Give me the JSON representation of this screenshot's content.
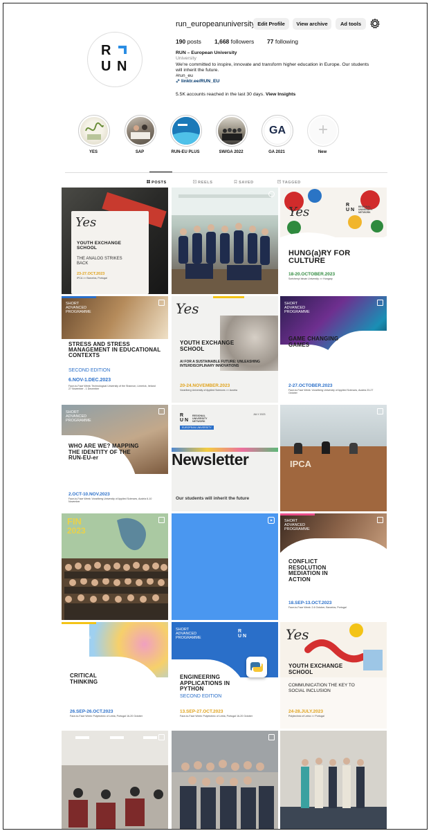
{
  "profile": {
    "username": "run_europeanuniversity",
    "logo_r": "R",
    "logo_u": "U",
    "logo_n": "N",
    "buttons": {
      "edit": "Edit Profile",
      "archive": "View archive",
      "ad_tools": "Ad tools"
    },
    "stats": {
      "posts_num": "190",
      "posts_lbl": "posts",
      "followers_num": "1,668",
      "followers_lbl": "followers",
      "following_num": "77",
      "following_lbl": "following"
    },
    "bio": {
      "name": "RUN – European University",
      "category": "University",
      "line1": "We're committed to inspire, innovate and transform higher education in Europe. Our students",
      "line2": "will inherit the future.",
      "hashtag": "#run_eu",
      "link": "linktr.ee/RUN_EU"
    },
    "insights_text": "5.5K accounts reached in the last 30 days.",
    "insights_link": "View Insights"
  },
  "highlights": [
    {
      "label": "YES"
    },
    {
      "label": "SAP"
    },
    {
      "label": "RUN-EU PLUS"
    },
    {
      "label": "SW/GA 2022"
    },
    {
      "label": "GA 2021"
    },
    {
      "label": "New"
    }
  ],
  "highlight_ga_text": "GA",
  "tabs": {
    "posts": "POSTS",
    "reels": "REELS",
    "saved": "SAVED",
    "tagged": "TAGGED"
  },
  "posts": {
    "p1": {
      "yes": "Yes",
      "title": "YOUTH EXCHANGE SCHOOL",
      "sub": "THE ANALOG STRIKES BACK",
      "date": "23-27.OCT.2023",
      "place": "IPCA >> Barcelos, Portugal"
    },
    "p3": {
      "yes": "Yes",
      "logo_r": "R",
      "logo_u": "U",
      "logo_n": "N",
      "logo_txt": "REGIONAL UNIVERSITY NETWORK",
      "title": "HUNG(a)RY FOR CULTURE",
      "date": "18-20.OCTOBER.2023",
      "place": "Széchenyi István University >> Hungary"
    },
    "p4": {
      "kicker": "SHORT ADVANCED PROGRAMME",
      "title": "STRESS AND STRESS MANAGEMENT IN EDUCATIONAL CONTEXTS",
      "sub": "SECOND EDITION",
      "date": "6.NOV-1.DEC.2023",
      "place": "Face-to-Face Week: Technological University of the Shannon, Limerick, Ireland 27 November - 1 December"
    },
    "p5": {
      "yes": "Yes",
      "title": "YOUTH EXCHANGE SCHOOL",
      "sub": "AI FOR A SUSTAINABLE FUTURE: UNLEASHING INTERDISCIPLINARY INNOVATIONS",
      "date": "20-24.NOVEMBER.2023",
      "place": "Vorarlberg University of Applied Sciences >> Austria"
    },
    "p6": {
      "kicker": "SHORT ADVANCED PROGRAMME",
      "title": "GAME CHANGING GAMES",
      "date": "2-27.OCTOBER.2023",
      "place": "Face-to-Face Week: Vorarlberg University of Applied Sciences, Austria 23-27 October"
    },
    "p7": {
      "kicker": "SHORT ADVANCED PROGRAMME",
      "title": "WHO ARE WE? MAPPING THE IDENTITY OF THE RUN-EU-er",
      "date": "2.OCT-10.NOV.2023",
      "place": "Face-to-Face Week: Vorarlberg University of Applied Sciences, Austria 6-10 November"
    },
    "p8": {
      "logo_txt": "REGIONAL UNIVERSITY NETWORK",
      "tag": "EUROPEAN UNIVERSITY",
      "issue": "JULY 2023",
      "title": "Newsletter",
      "sub": "Our students will inherit the future"
    },
    "p9": {
      "sign": "IPCA"
    },
    "p10": {
      "word": "FIN",
      "year": "2023"
    },
    "p12": {
      "kicker": "SHORT ADVANCED PROGRAMME",
      "title": "CONFLICT RESOLUTION MEDIATION IN ACTION",
      "date": "18.SEP-13.OCT.2023",
      "place": "Face-to-Face Week: 2-6 October, Barcelos, Portugal"
    },
    "p13": {
      "kicker": "SHORT ADVANCED PROGRAMME",
      "title": "CRITICAL THINKING",
      "date": "26.SEP-26.OCT.2023",
      "place": "Face-to-Face Week: Polytechnic of Leiria, Portugal 16-20 October"
    },
    "p14": {
      "kicker": "SHORT ADVANCED PROGRAMME",
      "title": "ENGINEERING APPLICATIONS IN PYTHON",
      "sub": "SECOND EDITION",
      "date": "13.SEP-27.OCT.2023",
      "place": "Face-to-Face Week: Polytechnic of Leiria, Portugal 16-20 October"
    },
    "p15": {
      "yes": "Yes",
      "title": "YOUTH EXCHANGE SCHOOL",
      "sub": "COMMUNICATION THE KEY TO SOCIAL INCLUSION",
      "date": "24-28.JULY.2023",
      "place": "Polytechnic of Leiria >> Portugal"
    }
  },
  "colors": {
    "accent": "#2a6fc9",
    "link": "#00376b",
    "yellow": "#f3c316",
    "blue_tile": "#4a97f0"
  }
}
